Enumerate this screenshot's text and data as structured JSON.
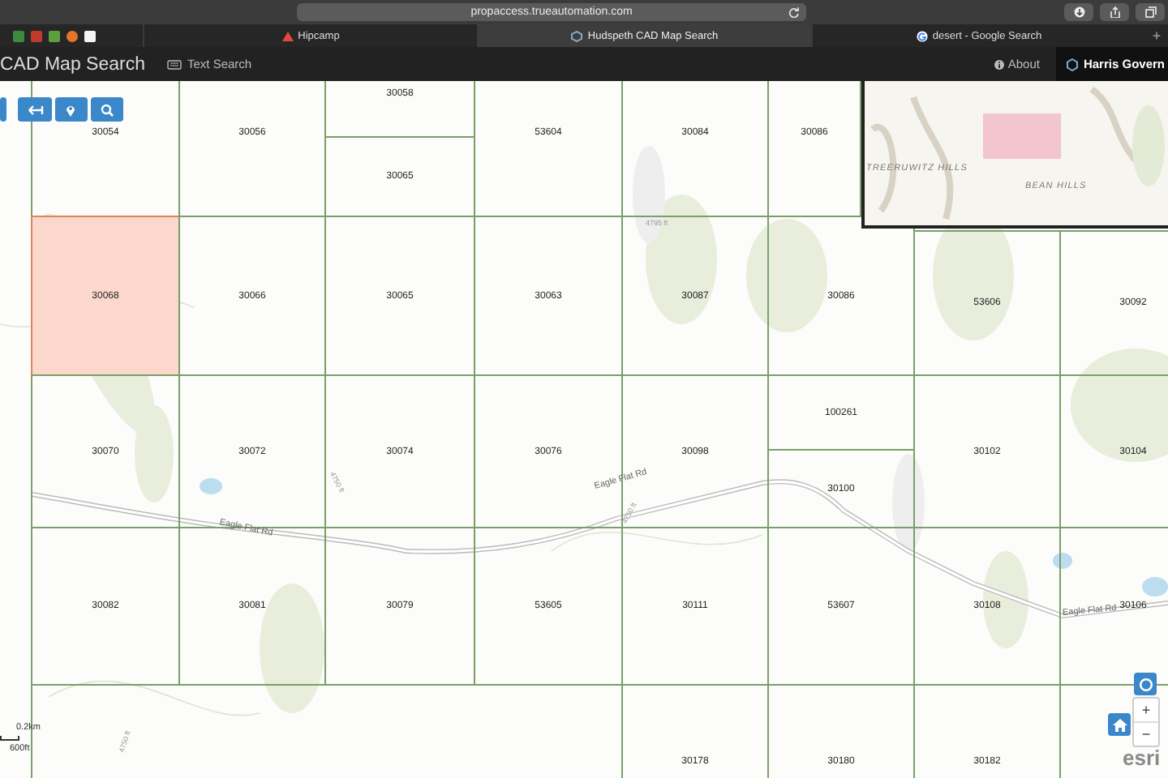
{
  "browser": {
    "url": "propaccess.trueautomation.com",
    "tabs": [
      {
        "title": "Hipcamp",
        "selected": false
      },
      {
        "title": "Hudspeth CAD Map Search",
        "selected": true
      },
      {
        "title": "desert - Google Search",
        "selected": false
      }
    ],
    "new_tab": "+"
  },
  "app": {
    "title": "CAD Map Search",
    "nav": [
      {
        "label": "Text Search"
      }
    ],
    "about": "About",
    "account": "Harris Govern"
  },
  "map": {
    "parcels": [
      {
        "label": "30054",
        "selected": false
      },
      {
        "label": "30056",
        "selected": false
      },
      {
        "label": "30058",
        "selected": false
      },
      {
        "label": "30065",
        "selected": false
      },
      {
        "label": "53604",
        "selected": false
      },
      {
        "label": "30084",
        "selected": false
      },
      {
        "label": "30086",
        "selected": false
      },
      {
        "label": "30068",
        "selected": true
      },
      {
        "label": "30066",
        "selected": false
      },
      {
        "label": "30065",
        "selected": false
      },
      {
        "label": "30063",
        "selected": false
      },
      {
        "label": "30087",
        "selected": false
      },
      {
        "label": "30086",
        "selected": false
      },
      {
        "label": "53606",
        "selected": false
      },
      {
        "label": "30092",
        "selected": false
      },
      {
        "label": "30070",
        "selected": false
      },
      {
        "label": "30072",
        "selected": false
      },
      {
        "label": "30074",
        "selected": false
      },
      {
        "label": "30076",
        "selected": false
      },
      {
        "label": "30098",
        "selected": false
      },
      {
        "label": "100261",
        "selected": false
      },
      {
        "label": "30100",
        "selected": false
      },
      {
        "label": "30102",
        "selected": false
      },
      {
        "label": "30104",
        "selected": false
      },
      {
        "label": "30082",
        "selected": false
      },
      {
        "label": "30081",
        "selected": false
      },
      {
        "label": "30079",
        "selected": false
      },
      {
        "label": "53605",
        "selected": false
      },
      {
        "label": "30111",
        "selected": false
      },
      {
        "label": "53607",
        "selected": false
      },
      {
        "label": "30108",
        "selected": false
      },
      {
        "label": "30106",
        "selected": false
      },
      {
        "label": "30178",
        "selected": false
      },
      {
        "label": "30180",
        "selected": false
      },
      {
        "label": "30182",
        "selected": false
      }
    ],
    "roads": [
      {
        "label": "Eagle Flat Rd"
      },
      {
        "label": "Eagle Flat Rd"
      },
      {
        "label": "Eagle Flat Rd"
      }
    ],
    "elevations": [
      "4795 ft",
      "4750 ft",
      "4750 ft",
      "4750 ft"
    ],
    "overview": {
      "labels": [
        "TREERUWITZ HILLS",
        "BEAN HILLS"
      ]
    },
    "scale": {
      "metric": "0.2km",
      "imperial": "600ft"
    },
    "zoom": {
      "in": "+",
      "out": "−"
    },
    "attribution": "esri"
  }
}
